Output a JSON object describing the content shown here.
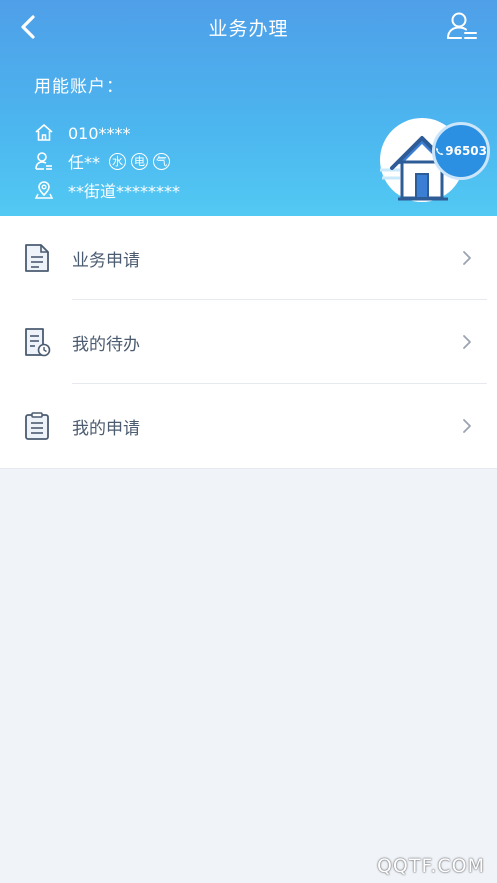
{
  "header": {
    "title": "业务办理",
    "account_label": "用能账户：",
    "account_number": "010****",
    "user_name": "任**",
    "service_tags": [
      "水",
      "电",
      "气"
    ],
    "address": "**街道********",
    "hotline": "96503"
  },
  "menu": {
    "items": [
      {
        "label": "业务申请",
        "icon": "document-icon"
      },
      {
        "label": "我的待办",
        "icon": "pending-document-icon"
      },
      {
        "label": "我的申请",
        "icon": "clipboard-icon"
      }
    ]
  },
  "watermark": "QQTF.COM",
  "colors": {
    "header_top": "#4f9fe8",
    "header_bottom": "#52c9f3",
    "accent": "#2b8fe2",
    "menu_text": "#4b5b70",
    "page_bg": "#f0f4f9"
  }
}
